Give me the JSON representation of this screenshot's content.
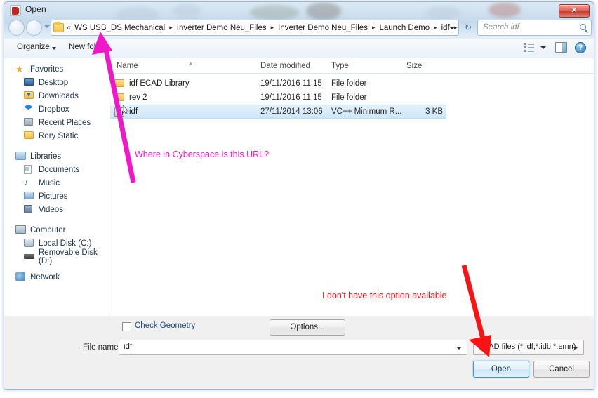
{
  "window": {
    "title": "Open",
    "icon": "app-icon",
    "close_label": "✕"
  },
  "navigation": {
    "back_icon": "back-arrow-icon",
    "forward_icon": "forward-arrow-icon",
    "recent_icon": "chevron-down-icon",
    "address": {
      "overflow_chevrons": "«",
      "separator": "▸",
      "crumbs": [
        "WS USB_DS Mechanical",
        "Inverter Demo Neu_Files",
        "Inverter Demo Neu_Files",
        "Launch Demo",
        "idf"
      ],
      "dropdown_icon": "chevron-down-icon"
    },
    "refresh_icon": "refresh-icon",
    "refresh_glyph": "↻",
    "search": {
      "placeholder": "Search idf",
      "icon": "search-icon"
    }
  },
  "commandbar": {
    "organize_label": "Organize",
    "new_folder_label": "New fold",
    "view_icon": "list-view-icon",
    "preview_icon": "preview-pane-icon",
    "help_icon": "help-icon",
    "help_glyph": "?"
  },
  "sidebar": {
    "groups": [
      {
        "header": "Favorites",
        "header_icon": "star-icon",
        "items": [
          {
            "label": "Desktop",
            "icon": "desktop-icon"
          },
          {
            "label": "Downloads",
            "icon": "downloads-icon"
          },
          {
            "label": "Dropbox",
            "icon": "dropbox-icon"
          },
          {
            "label": "Recent Places",
            "icon": "recent-places-icon"
          },
          {
            "label": "Rory Static",
            "icon": "folder-icon"
          }
        ]
      },
      {
        "header": "Libraries",
        "header_icon": "libraries-icon",
        "items": [
          {
            "label": "Documents",
            "icon": "documents-icon"
          },
          {
            "label": "Music",
            "icon": "music-icon"
          },
          {
            "label": "Pictures",
            "icon": "pictures-icon"
          },
          {
            "label": "Videos",
            "icon": "videos-icon"
          }
        ]
      },
      {
        "header": "Computer",
        "header_icon": "computer-icon",
        "items": [
          {
            "label": "Local Disk (C:)",
            "icon": "hard-disk-icon"
          },
          {
            "label": "Removable Disk (D:)",
            "icon": "removable-disk-icon"
          }
        ]
      },
      {
        "header": "Network",
        "header_icon": "network-icon",
        "items": []
      }
    ]
  },
  "filelist": {
    "columns": [
      "Name",
      "Date modified",
      "Type",
      "Size"
    ],
    "sort_indicator": "▲",
    "rows": [
      {
        "name": "idf ECAD Library",
        "date_modified": "19/11/2016 11:15",
        "type": "File folder",
        "size": "",
        "icon": "folder-icon",
        "selected": false
      },
      {
        "name": "rev 2",
        "date_modified": "19/11/2016 11:15",
        "type": "File folder",
        "size": "",
        "icon": "folder-icon",
        "selected": false
      },
      {
        "name": "idf",
        "date_modified": "27/11/2014 13:06",
        "type": "VC++ Minimum R...",
        "size": "3 KB",
        "icon": "file-icon",
        "selected": true
      }
    ]
  },
  "bottom": {
    "check_geometry_label": "Check Geometry",
    "check_geometry_checked": false,
    "options_label": "Options...",
    "filename_label": "File name:",
    "filename_value": "idf",
    "filetype_value": "ECAD files (*.idf;*.idb;*.emn)",
    "open_label": "Open",
    "cancel_label": "Cancel"
  },
  "annotations": {
    "magenta_text": "Where in Cyberspace is this URL?",
    "magenta_color": "#ef18c8",
    "red_text": "I don't have this option available",
    "red_color": "#f81414"
  }
}
